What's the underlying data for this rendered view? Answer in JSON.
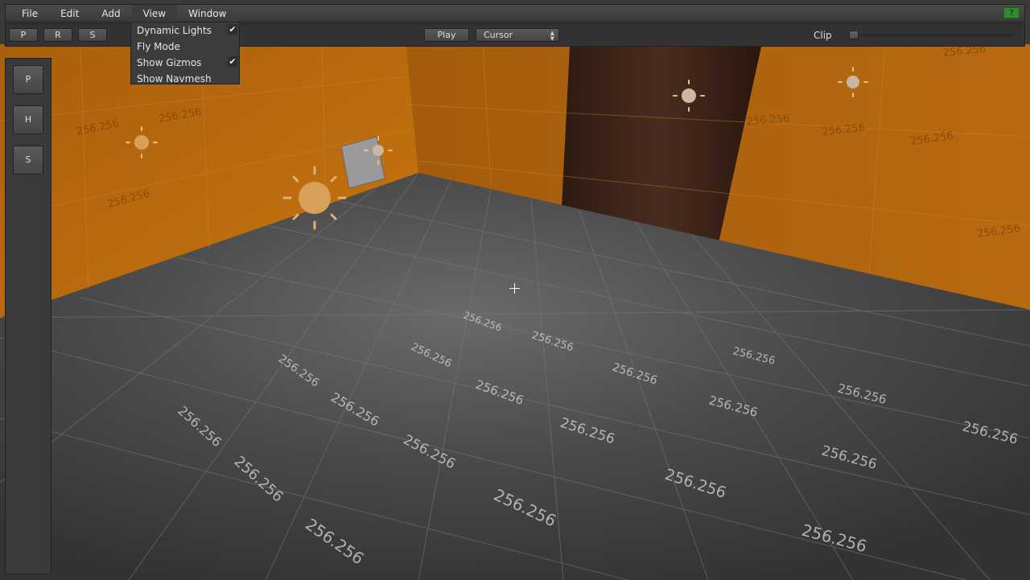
{
  "menubar": {
    "items": [
      "File",
      "Edit",
      "Add",
      "View",
      "Window"
    ],
    "help_label": "?"
  },
  "toolbar": {
    "left_buttons": [
      "P",
      "R",
      "S"
    ],
    "play_label": "Play",
    "mode_select": "Cursor",
    "clip_label": "Clip",
    "clip_value": 0
  },
  "left_panel": {
    "buttons": [
      "P",
      "H",
      "S"
    ]
  },
  "view_menu": {
    "items": [
      {
        "label": "Dynamic Lights",
        "checked": true
      },
      {
        "label": "Fly Mode",
        "checked": false
      },
      {
        "label": "Show Gizmos",
        "checked": true
      },
      {
        "label": "Show Navmesh",
        "checked": false
      }
    ]
  },
  "scene": {
    "grid_label": "256.256",
    "colors": {
      "wall": "#b86a10",
      "floor": "#4a4a4a",
      "door": "#3b2218",
      "light_icon": "#d8a058"
    }
  }
}
